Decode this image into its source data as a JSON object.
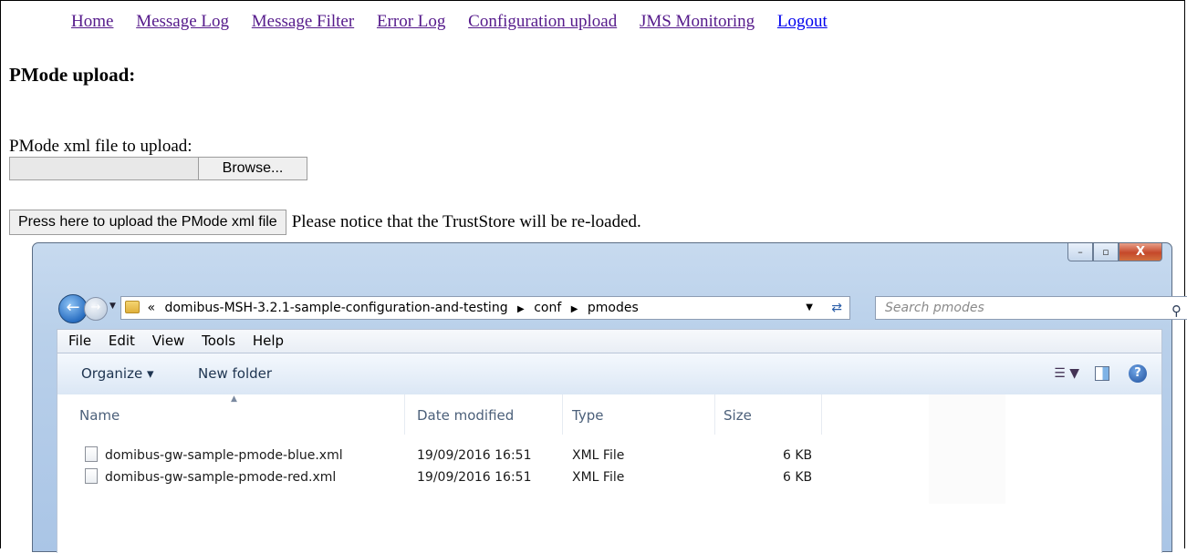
{
  "nav": {
    "links": [
      "Home",
      "Message Log",
      "Message Filter",
      "Error Log",
      "Configuration upload",
      "JMS Monitoring",
      "Logout"
    ]
  },
  "page": {
    "title": "PMode upload:",
    "file_label": "PMode xml file to upload:",
    "browse_label": "Browse...",
    "upload_button": "Press here to upload the PMode xml file",
    "upload_note": "Please notice that the TrustStore will be re-loaded."
  },
  "explorer": {
    "window_buttons": {
      "minimize": "–",
      "maximize": "▫",
      "close": "X"
    },
    "breadcrumb": {
      "prefix": "«",
      "items": [
        "domibus-MSH-3.2.1-sample-configuration-and-testing",
        "conf",
        "pmodes"
      ]
    },
    "search_placeholder": "Search pmodes",
    "menu": [
      "File",
      "Edit",
      "View",
      "Tools",
      "Help"
    ],
    "toolbar": {
      "organize": "Organize ▾",
      "new_folder": "New folder"
    },
    "columns": [
      "Name",
      "Date modified",
      "Type",
      "Size"
    ],
    "files": [
      {
        "name": "domibus-gw-sample-pmode-blue.xml",
        "date": "19/09/2016 16:51",
        "type": "XML File",
        "size": "6 KB"
      },
      {
        "name": "domibus-gw-sample-pmode-red.xml",
        "date": "19/09/2016 16:51",
        "type": "XML File",
        "size": "6 KB"
      }
    ]
  }
}
